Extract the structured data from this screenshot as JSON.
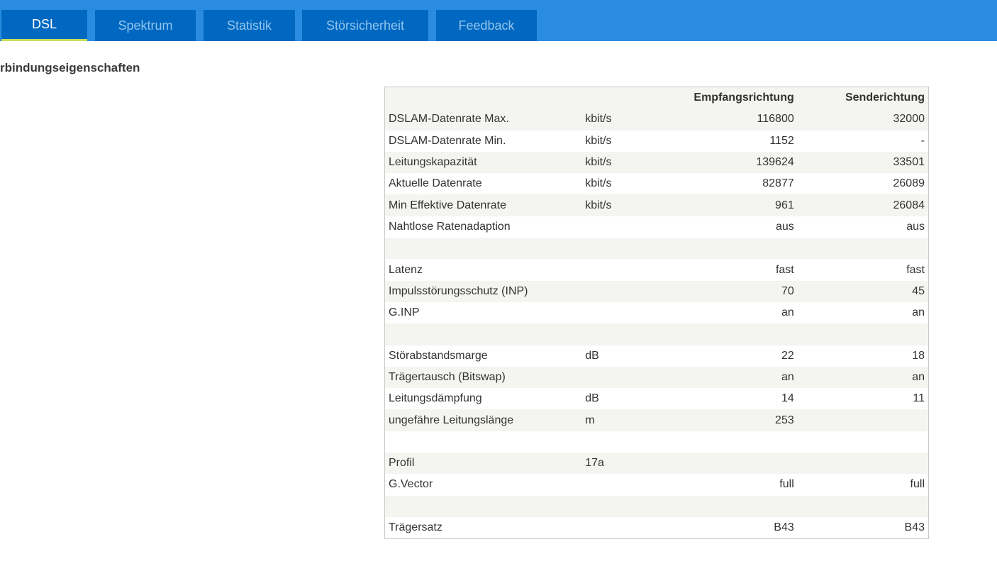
{
  "tabs": [
    {
      "label": "DSL",
      "active": true
    },
    {
      "label": "Spektrum"
    },
    {
      "label": "Statistik"
    },
    {
      "label": "Störsicherheit"
    },
    {
      "label": "Feedback"
    }
  ],
  "section_title": "rbindungseigenschaften",
  "table": {
    "headers": [
      "",
      "",
      "Empfangsrichtung",
      "Senderichtung"
    ],
    "rows": [
      [
        "DSLAM-Datenrate Max.",
        "kbit/s",
        "116800",
        "32000"
      ],
      [
        "DSLAM-Datenrate Min.",
        "kbit/s",
        "1152",
        "-"
      ],
      [
        "Leitungskapazität",
        "kbit/s",
        "139624",
        "33501"
      ],
      [
        "Aktuelle Datenrate",
        "kbit/s",
        "82877",
        "26089"
      ],
      [
        "Min Effektive Datenrate",
        "kbit/s",
        "961",
        "26084"
      ],
      [
        "Nahtlose Ratenadaption",
        "",
        "aus",
        "aus"
      ],
      [
        "",
        "",
        "",
        ""
      ],
      [
        "Latenz",
        "",
        "fast",
        "fast"
      ],
      [
        "Impulsstörungsschutz (INP)",
        "",
        "70",
        "45"
      ],
      [
        "G.INP",
        "",
        "an",
        "an"
      ],
      [
        "",
        "",
        "",
        ""
      ],
      [
        "Störabstandsmarge",
        "dB",
        "22",
        "18"
      ],
      [
        "Trägertausch (Bitswap)",
        "",
        "an",
        "an"
      ],
      [
        "Leitungsdämpfung",
        "dB",
        "14",
        "11"
      ],
      [
        "ungefähre Leitungslänge",
        "m",
        "253",
        ""
      ],
      [
        "",
        "",
        "",
        ""
      ],
      [
        "Profil",
        "17a",
        "",
        ""
      ],
      [
        "G.Vector",
        "",
        "full",
        "full"
      ],
      [
        "",
        "",
        "",
        ""
      ],
      [
        "Trägersatz",
        "",
        "B43",
        "B43"
      ]
    ]
  },
  "colors": {
    "topbar": "#2a8ce0",
    "tab": "#0068c0",
    "active_underline": "#c4e05a"
  }
}
